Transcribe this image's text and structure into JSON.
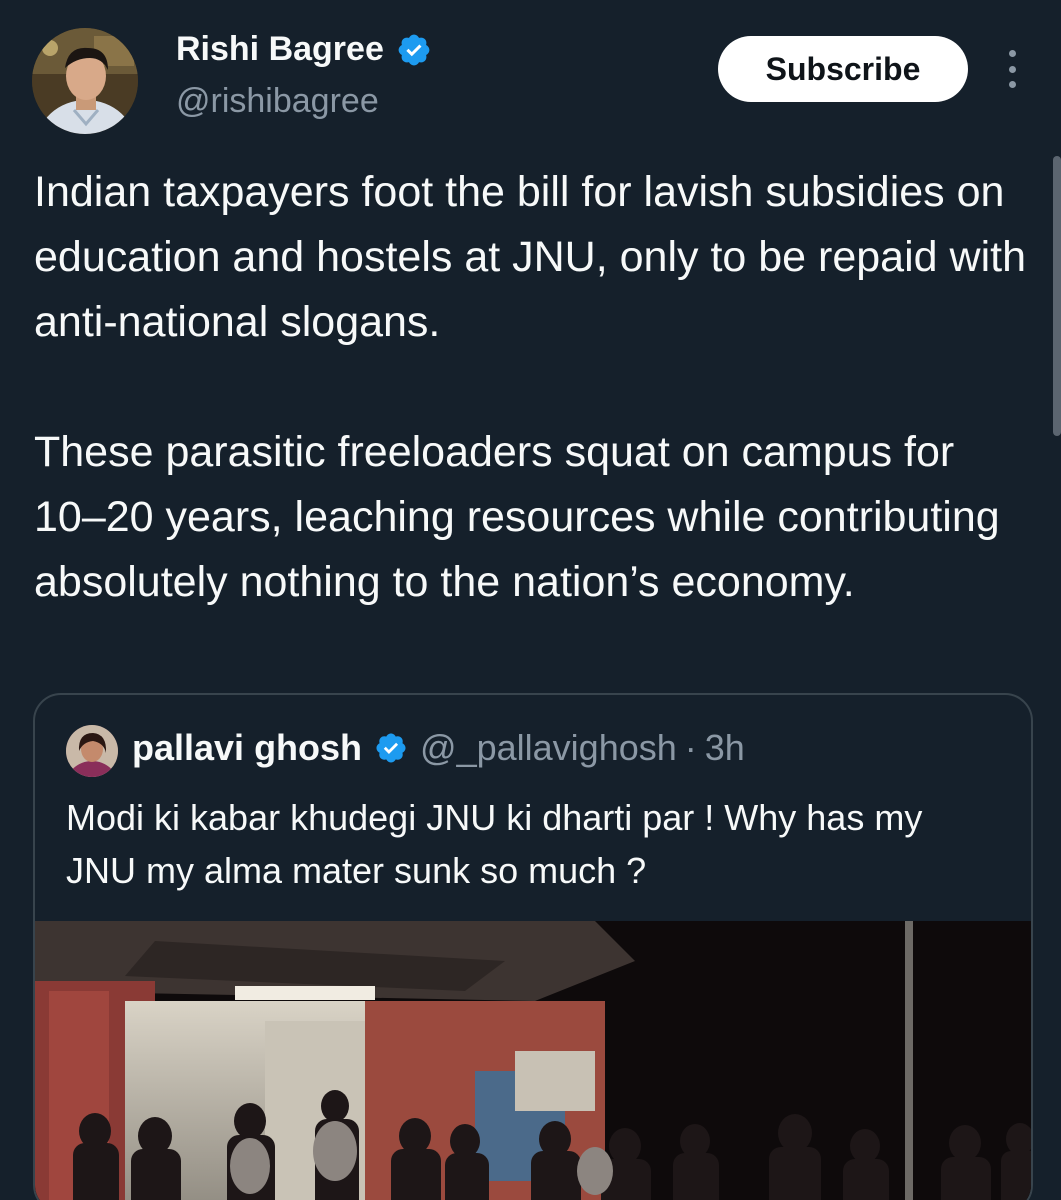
{
  "tweet": {
    "author_name": "Rishi Bagree",
    "author_handle": "@rishibagree",
    "verified_icon": "verified-badge-icon",
    "subscribe_label": "Subscribe",
    "text": "Indian taxpayers foot the bill for lavish subsidies on education and hostels at JNU, only to be repaid with anti-national slogans.\n\nThese parasitic freeloaders squat on campus for 10–20 years, leaching resources while contributing absolutely nothing to the nation’s economy."
  },
  "quoted_tweet": {
    "author_name": "pallavi ghosh",
    "author_handle": "@_pallavighosh",
    "separator": "·",
    "time": "3h",
    "text": "Modi ki kabar khudegi JNU ki dharti par ! Why has my JNU my alma mater sunk so much ?"
  },
  "colors": {
    "background": "#15202b",
    "verified": "#1d9bf0",
    "secondary_text": "#8b98a5",
    "card_border": "#38444d",
    "button_bg": "#ffffff"
  }
}
